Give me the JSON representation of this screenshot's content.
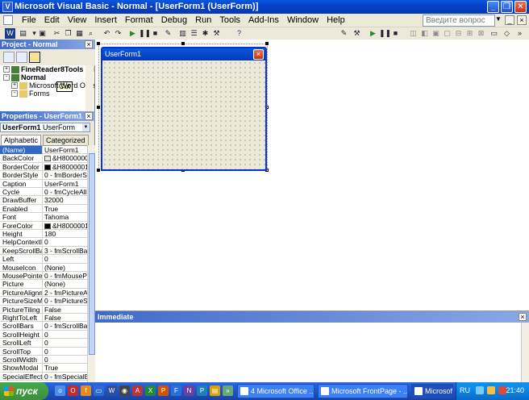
{
  "window": {
    "title": "Microsoft Visual Basic - Normal - [UserForm1 (UserForm)]",
    "app_icon": "vb-icon"
  },
  "menu": {
    "items": [
      "File",
      "Edit",
      "View",
      "Insert",
      "Format",
      "Debug",
      "Run",
      "Tools",
      "Add-Ins",
      "Window",
      "Help"
    ],
    "help_placeholder": "Введите вопрос"
  },
  "toolbar": {
    "tooltip": "Cut"
  },
  "project": {
    "title": "Project - Normal",
    "tree": [
      {
        "label": "FineReader8Tools (Fi",
        "bold": true,
        "expander": "+"
      },
      {
        "label": "Normal",
        "bold": true,
        "expander": "-"
      },
      {
        "label": "Microsoft Word Objec",
        "bold": false,
        "expander": "+"
      },
      {
        "label": "Forms",
        "bold": false,
        "expander": "-"
      }
    ]
  },
  "properties": {
    "title": "Properties - UserForm1",
    "object_name": "UserForm1",
    "object_type": "UserForm",
    "tabs": [
      "Alphabetic",
      "Categorized"
    ],
    "rows": [
      {
        "name": "(Name)",
        "value": "UserForm1",
        "selected": true
      },
      {
        "name": "BackColor",
        "value": "&H8000000",
        "swatch": "#ECE9D8"
      },
      {
        "name": "BorderColor",
        "value": "&H8000001",
        "swatch": "#000000"
      },
      {
        "name": "BorderStyle",
        "value": "0 - fmBorderSt"
      },
      {
        "name": "Caption",
        "value": "UserForm1"
      },
      {
        "name": "Cycle",
        "value": "0 - fmCycleAllF"
      },
      {
        "name": "DrawBuffer",
        "value": "32000"
      },
      {
        "name": "Enabled",
        "value": "True"
      },
      {
        "name": "Font",
        "value": "Tahoma"
      },
      {
        "name": "ForeColor",
        "value": "&H8000001",
        "swatch": "#000000"
      },
      {
        "name": "Height",
        "value": "180"
      },
      {
        "name": "HelpContextID",
        "value": "0"
      },
      {
        "name": "KeepScrollBarsV",
        "value": "3 - fmScrollBar"
      },
      {
        "name": "Left",
        "value": "0"
      },
      {
        "name": "MouseIcon",
        "value": "(None)"
      },
      {
        "name": "MousePointer",
        "value": "0 - fmMousePo"
      },
      {
        "name": "Picture",
        "value": "(None)"
      },
      {
        "name": "PictureAlignmen",
        "value": "2 - fmPictureAl"
      },
      {
        "name": "PictureSizeMode",
        "value": "0 - fmPictureSi"
      },
      {
        "name": "PictureTiling",
        "value": "False"
      },
      {
        "name": "RightToLeft",
        "value": "False"
      },
      {
        "name": "ScrollBars",
        "value": "0 - fmScrollBar"
      },
      {
        "name": "ScrollHeight",
        "value": "0"
      },
      {
        "name": "ScrollLeft",
        "value": "0"
      },
      {
        "name": "ScrollTop",
        "value": "0"
      },
      {
        "name": "ScrollWidth",
        "value": "0"
      },
      {
        "name": "ShowModal",
        "value": "True"
      },
      {
        "name": "SpecialEffect",
        "value": "0 - fmSpecialEf"
      }
    ]
  },
  "userform": {
    "caption": "UserForm1"
  },
  "immediate": {
    "title": "Immediate"
  },
  "taskbar": {
    "start_label": "пуск",
    "tasks": [
      {
        "label": "4 Microsoft Office ...",
        "active": false
      },
      {
        "label": "Microsoft FrontPage - ...",
        "active": false
      },
      {
        "label": "Microsoft Word",
        "active": true
      }
    ],
    "language": "RU",
    "clock": "21:40"
  }
}
